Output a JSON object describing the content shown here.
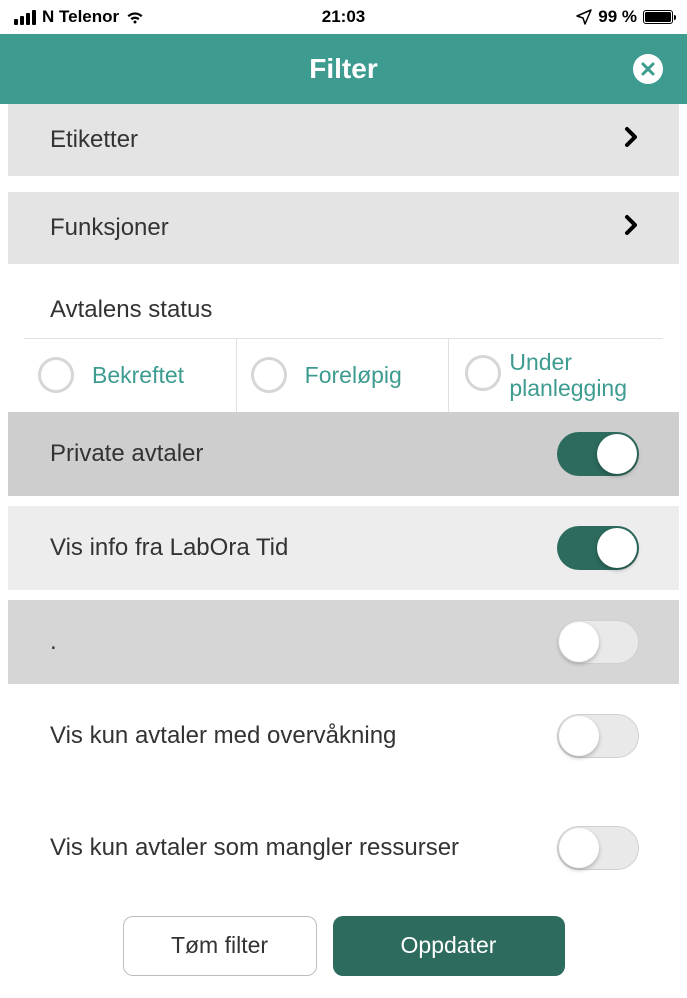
{
  "status_bar": {
    "carrier": "N Telenor",
    "time": "21:03",
    "battery_pct": "99 %"
  },
  "header": {
    "title": "Filter"
  },
  "nav": {
    "etiketter": "Etiketter",
    "funksjoner": "Funksjoner"
  },
  "status_section": {
    "label": "Avtalens status",
    "options": {
      "bekreftet": "Bekreftet",
      "forelopig": "Foreløpig",
      "under_planlegging": "Under planlegging"
    }
  },
  "toggles": {
    "private_avtaler": "Private avtaler",
    "labora_tid": "Vis info fra LabOra Tid",
    "dot": ".",
    "overvakning": "Vis kun avtaler med overvåkning",
    "mangler_ressurser": "Vis kun avtaler som mangler ressurser"
  },
  "footer": {
    "clear": "Tøm filter",
    "update": "Oppdater"
  }
}
